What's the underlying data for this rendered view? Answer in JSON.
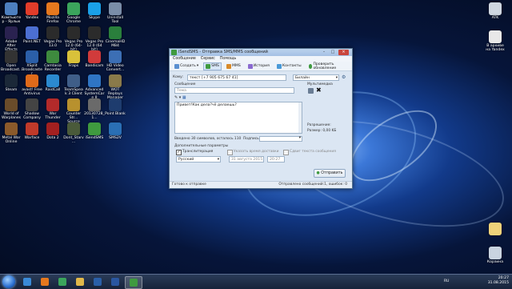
{
  "desktop": {
    "left_icons": [
      {
        "label": "Компьютер - Ярлык",
        "icon": "computer-icon",
        "color": "#4d7fbf"
      },
      {
        "label": "Yandex",
        "icon": "yandex-icon",
        "color": "#e23c2a"
      },
      {
        "label": "Mozilla Firefox",
        "icon": "firefox-icon",
        "color": "#e6781e"
      },
      {
        "label": "Google Chrome",
        "icon": "chrome-icon",
        "color": "#3ba55c"
      },
      {
        "label": "Skype",
        "icon": "skype-icon",
        "color": "#1aa0e8"
      },
      {
        "label": "Uninstall Tool",
        "icon": "uninstall-icon",
        "color": "#7a8da8"
      },
      {
        "label": "Adobe After Effects CS5.5",
        "icon": "after-effects-icon",
        "color": "#2a2250"
      },
      {
        "label": "Paint.NET",
        "icon": "paintnet-icon",
        "color": "#4c6fd1"
      },
      {
        "label": "Vegas Pro 13.0",
        "icon": "vegas-icon",
        "color": "#2b2b2b"
      },
      {
        "label": "Vegas Pro 12.0 (64-bit)",
        "icon": "vegas-icon",
        "color": "#2b2b2b"
      },
      {
        "label": "Vegas Pro 12.0 (64 bit)",
        "icon": "vegas-icon",
        "color": "#2b2b2b"
      },
      {
        "label": "CinemaHD M84",
        "icon": "cinema-icon",
        "color": "#2a7f3c"
      },
      {
        "label": "Open Broadcast...",
        "icon": "obs-icon",
        "color": "#333333"
      },
      {
        "label": "XSplit Broadcaster",
        "icon": "xsplit-icon",
        "color": "#2b5fa8"
      },
      {
        "label": "Camtasia Recorder",
        "icon": "camtasia-icon",
        "color": "#3e8a3e"
      },
      {
        "label": "Fraps",
        "icon": "fraps-icon",
        "color": "#d9c13a"
      },
      {
        "label": "Bandicam",
        "icon": "bandicam-icon",
        "color": "#d13b3b"
      },
      {
        "label": "HD Video Convert...",
        "icon": "converter-icon",
        "color": "#3c6fb5"
      },
      {
        "label": "Steam",
        "icon": "steam-icon",
        "color": "#1b2838"
      },
      {
        "label": "avast! Free Antivirus",
        "icon": "avast-icon",
        "color": "#e06a1a"
      },
      {
        "label": "RaidCall",
        "icon": "raidcall-icon",
        "color": "#2b8ad0"
      },
      {
        "label": "TeamSpeak 3 Client",
        "icon": "teamspeak-icon",
        "color": "#3f5e88"
      },
      {
        "label": "Advanced SystemCare 8",
        "icon": "systemcare-icon",
        "color": "#2f75c4"
      },
      {
        "label": "WOT Replays Manager",
        "icon": "wot-replays-icon",
        "color": "#8a7a4a"
      },
      {
        "label": "World of Warplanes",
        "icon": "warplanes-icon",
        "color": "#6a4c2a"
      },
      {
        "label": "Shadow Company",
        "icon": "shadow-company-icon",
        "color": "#444444"
      },
      {
        "label": "War Thunder",
        "icon": "war-thunder-icon",
        "color": "#b32a2a"
      },
      {
        "label": "Counter Str... Source",
        "icon": "counter-strike-icon",
        "color": "#b8912e"
      },
      {
        "label": "20130728_1...",
        "icon": "video-file-icon",
        "color": "#6a6a6a"
      },
      {
        "label": "Point Blank",
        "icon": "point-blank-icon",
        "color": "#1e3c6e"
      },
      {
        "label": "Metal War Online",
        "icon": "metal-war-icon",
        "color": "#8b5a2b"
      },
      {
        "label": "Warface",
        "icon": "warface-icon",
        "color": "#c03a2a"
      },
      {
        "label": "Dota 2",
        "icon": "dota2-icon",
        "color": "#a32020"
      },
      {
        "label": "Dont_Starv...",
        "icon": "dont-starve-icon",
        "color": "#4a5a3a"
      },
      {
        "label": "iSendSMS",
        "icon": "isendsms-icon",
        "color": "#3f9a3f"
      },
      {
        "label": "SMS2V",
        "icon": "sms2v-icon",
        "color": "#2a6fb5"
      }
    ],
    "right_icons": [
      {
        "label": "ATK",
        "icon": "atk-icon",
        "color": "#cfd6e0"
      },
      {
        "label": "В архиве на Yandex",
        "icon": "archive-icon",
        "color": "#e8e8e8"
      },
      {
        "label": "",
        "icon": "folder-icon",
        "color": "#f0d27a"
      },
      {
        "label": "Корзина",
        "icon": "recycle-bin-icon",
        "color": "#c9d3e0"
      }
    ]
  },
  "window": {
    "title": "iSendSMS - Отправка SMS/MMS сообщений",
    "menu": [
      "Сообщение",
      "Сервис",
      "Помощь"
    ],
    "toolbar": {
      "create": "Создать",
      "sms": "SMS",
      "mms": "MMS",
      "history": "История",
      "contacts": "Контакты",
      "update": "Проверить обновление"
    },
    "recipient_label": "Кому:",
    "recipient_value": "текст [+7 905 675 67 41]",
    "operator_value": "Билайн",
    "message_label": "Сообщение",
    "subject_placeholder": "Тема",
    "attachments_label": "Мультимедиа",
    "message_text": "Привет!Как дела?чё делаешь?",
    "chars_info": "Введено 30 символов, осталось 110",
    "signature_label": "Подпись",
    "resolution_label": "Разрешение:",
    "size_label": "Размер: 0,00 KБ",
    "extra_params_label": "Дополнительные параметры",
    "translit_label": "Транслитерация",
    "translit_checked": true,
    "delivery_time_label": "Указать время доставки",
    "delivery_date": "31 августа 2015",
    "delivery_time": "20:27",
    "notify_label": "Сдвиг текста сообщения",
    "language_value": "Русский",
    "send_label": "Отправить",
    "status_left": "Готово к отправке",
    "status_right": "Отправлено сообщений:1, ошибок: 0"
  },
  "taskbar": {
    "lang": "RU",
    "time": "20:27",
    "date": "31.08.2015",
    "apps": [
      {
        "icon": "ie-icon",
        "color": "#3a8ad8"
      },
      {
        "icon": "firefox-icon",
        "color": "#e6781e"
      },
      {
        "icon": "chrome-icon",
        "color": "#3ba55c"
      },
      {
        "icon": "explorer-icon",
        "color": "#e0b84a"
      },
      {
        "icon": "media-player-icon",
        "color": "#2a5fa8"
      },
      {
        "icon": "word-icon",
        "color": "#2a56a0"
      },
      {
        "icon": "isendsms-icon",
        "color": "#3f9a3f"
      }
    ]
  },
  "accent": "#3f9a3f"
}
